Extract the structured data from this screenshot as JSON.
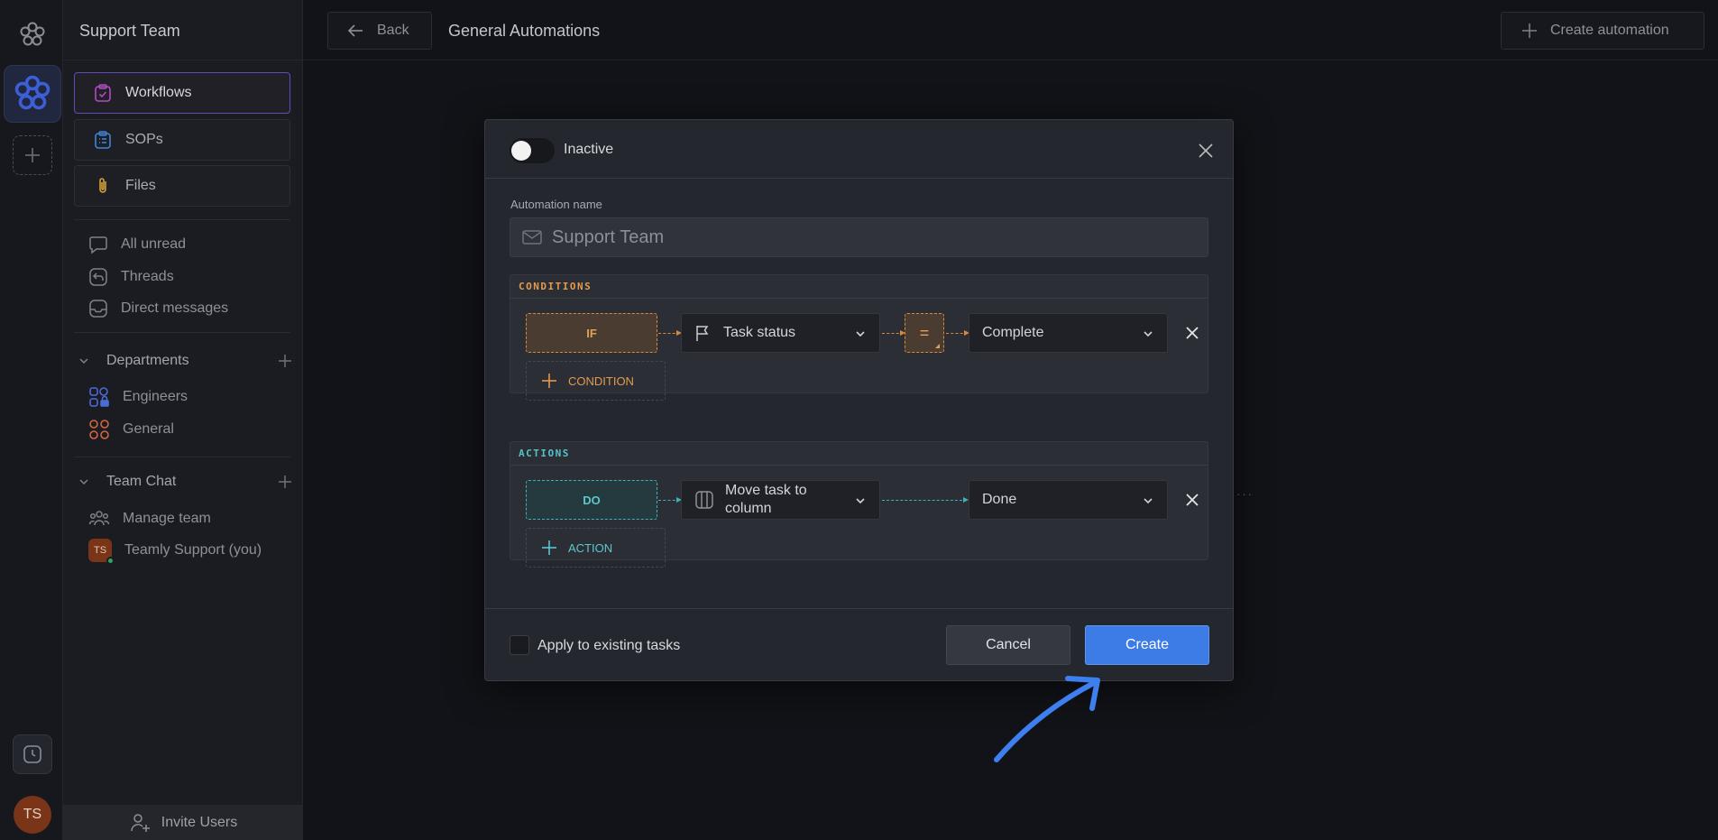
{
  "rail": {
    "user_initials": "TS",
    "workspace_logo": "flower-logo-icon"
  },
  "sidebar": {
    "team_name": "Support Team",
    "nav": [
      {
        "label": "Workflows",
        "icon": "clipboard-check-icon",
        "color": "#b04bc4"
      },
      {
        "label": "SOPs",
        "icon": "list-clipboard-icon",
        "color": "#3f83d6"
      },
      {
        "label": "Files",
        "icon": "paperclip-icon",
        "color": "#d0a13c"
      }
    ],
    "inbox": [
      {
        "label": "All unread",
        "icon": "chat-bubble-icon"
      },
      {
        "label": "Threads",
        "icon": "thread-reply-icon"
      },
      {
        "label": "Direct messages",
        "icon": "inbox-tray-icon"
      }
    ],
    "departments": {
      "title": "Departments",
      "items": [
        {
          "label": "Engineers",
          "icon": "grid-lock-icon",
          "color": "#4d6bd8"
        },
        {
          "label": "General",
          "icon": "grid-circles-icon",
          "color": "#d0683f"
        }
      ]
    },
    "team_chat": {
      "title": "Team Chat",
      "items": [
        {
          "label": "Manage team",
          "icon": "people-group-icon"
        },
        {
          "label": "Teamly Support (you)",
          "icon": "avatar",
          "initials": "TS"
        }
      ]
    },
    "invite_label": "Invite Users"
  },
  "header": {
    "back_label": "Back",
    "title": "General Automations",
    "create_label": "Create automation"
  },
  "modal": {
    "status_label": "Inactive",
    "status_active": false,
    "name_label": "Automation name",
    "name_placeholder": "Support Team",
    "name_value": "",
    "conditions_title": "CONDITIONS",
    "condition": {
      "tag": "IF",
      "field": "Task status",
      "operator": "=",
      "value": "Complete"
    },
    "add_condition_label": "CONDITION",
    "actions_title": "ACTIONS",
    "action": {
      "tag": "DO",
      "type": "Move task to column",
      "value": "Done"
    },
    "add_action_label": "ACTION",
    "apply_existing_label": "Apply to existing tasks",
    "apply_existing_checked": false,
    "cancel_label": "Cancel",
    "create_label": "Create"
  },
  "colors": {
    "accent_blue": "#3d7ce6",
    "condition_orange": "#e39a4c",
    "action_teal": "#5fc7cb",
    "annotation_arrow": "#3e7ff0"
  }
}
